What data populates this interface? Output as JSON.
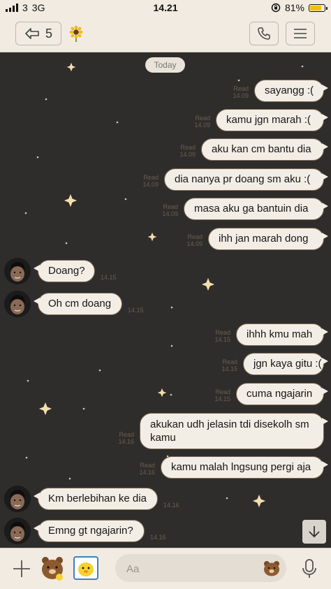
{
  "status_bar": {
    "carrier": "3",
    "network": "3G",
    "time": "14.21",
    "battery_percent": "81%",
    "battery_level": 0.81
  },
  "header": {
    "back_count": "5",
    "icons": [
      "back-arrow-icon",
      "sunflower-icon",
      "phone-icon",
      "menu-icon"
    ]
  },
  "chat": {
    "date_label": "Today",
    "messages": [
      {
        "dir": "out",
        "text": "sayangg :(",
        "status": "Read",
        "time": "14.09"
      },
      {
        "dir": "out",
        "text": "kamu jgn marah :(",
        "status": "Read",
        "time": "14.09"
      },
      {
        "dir": "out",
        "text": "aku kan cm bantu dia",
        "status": "Read",
        "time": "14.09"
      },
      {
        "dir": "out",
        "text": "dia nanya pr doang sm aku :(",
        "status": "Read",
        "time": "14.09"
      },
      {
        "dir": "out",
        "text": "masa aku ga bantuin dia",
        "status": "Read",
        "time": "14.09"
      },
      {
        "dir": "out",
        "text": "ihh jan marah dong",
        "status": "Read",
        "time": "14.09"
      },
      {
        "dir": "in",
        "text": "Doang?",
        "time": "14.15"
      },
      {
        "dir": "in",
        "text": "Oh cm doang",
        "time": "14.15"
      },
      {
        "dir": "out",
        "text": "ihhh kmu mah",
        "status": "Read",
        "time": "14.15"
      },
      {
        "dir": "out",
        "text": "jgn kaya gitu :(",
        "status": "Read",
        "time": "14.15"
      },
      {
        "dir": "out",
        "text": "cuma ngajarin",
        "status": "Read",
        "time": "14.15"
      },
      {
        "dir": "out",
        "text": "akukan udh jelasin tdi disekolh sm kamu",
        "status": "Read",
        "time": "14.16"
      },
      {
        "dir": "out",
        "text": "kamu malah lngsung pergi aja",
        "status": "Read",
        "time": "14.16"
      },
      {
        "dir": "in",
        "text": "Km berlebihan ke dia",
        "time": "14.16"
      },
      {
        "dir": "in",
        "text": "Emng gt ngajarin?",
        "time": "14.16"
      }
    ]
  },
  "input": {
    "placeholder": "Aa",
    "value": ""
  },
  "colors": {
    "bar_bg": "#f1ebe1",
    "chat_bg": "#2f2d2b",
    "bubble": "#f3eee5",
    "battery": "#f2c200",
    "star": "#f3dfae"
  }
}
